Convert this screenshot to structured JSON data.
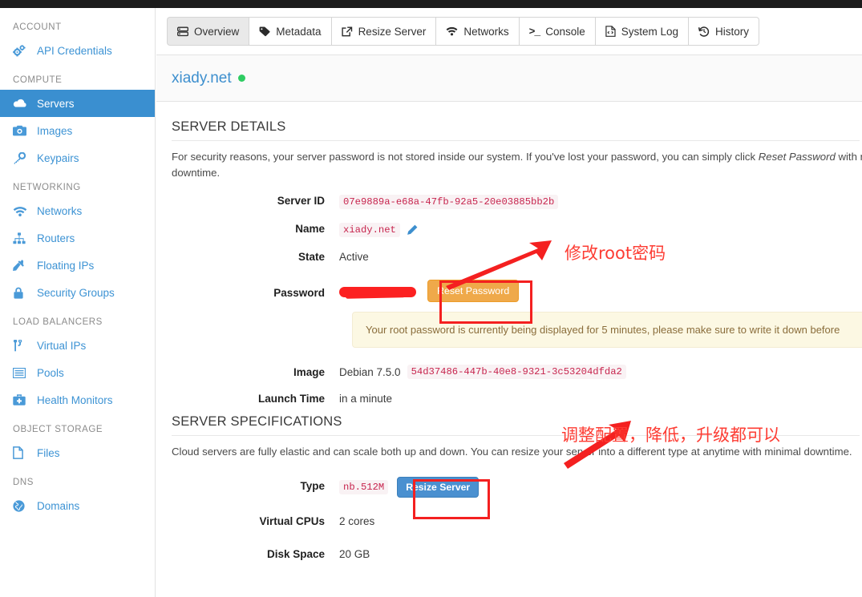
{
  "sidebar": {
    "sections": [
      {
        "label": "ACCOUNT",
        "items": [
          {
            "label": "API Credentials",
            "icon": "gears-icon",
            "active": false
          }
        ]
      },
      {
        "label": "COMPUTE",
        "items": [
          {
            "label": "Servers",
            "icon": "cloud-icon",
            "active": true
          },
          {
            "label": "Images",
            "icon": "camera-icon",
            "active": false
          },
          {
            "label": "Keypairs",
            "icon": "key-icon",
            "active": false
          }
        ]
      },
      {
        "label": "NETWORKING",
        "items": [
          {
            "label": "Networks",
            "icon": "wifi-icon",
            "active": false
          },
          {
            "label": "Routers",
            "icon": "sitemap-icon",
            "active": false
          },
          {
            "label": "Floating IPs",
            "icon": "plug-icon",
            "active": false
          },
          {
            "label": "Security Groups",
            "icon": "lock-icon",
            "active": false
          }
        ]
      },
      {
        "label": "LOAD BALANCERS",
        "items": [
          {
            "label": "Virtual IPs",
            "icon": "code-fork-icon",
            "active": false
          },
          {
            "label": "Pools",
            "icon": "list-icon",
            "active": false
          },
          {
            "label": "Health Monitors",
            "icon": "medkit-icon",
            "active": false
          }
        ]
      },
      {
        "label": "OBJECT STORAGE",
        "items": [
          {
            "label": "Files",
            "icon": "file-icon",
            "active": false
          }
        ]
      },
      {
        "label": "DNS",
        "items": [
          {
            "label": "Domains",
            "icon": "globe-icon",
            "active": false
          }
        ]
      }
    ]
  },
  "tabs": [
    {
      "label": "Overview",
      "icon": "server-icon",
      "active": true
    },
    {
      "label": "Metadata",
      "icon": "tag-icon",
      "active": false
    },
    {
      "label": "Resize Server",
      "icon": "external-link-icon",
      "active": false
    },
    {
      "label": "Networks",
      "icon": "wifi-icon",
      "active": false
    },
    {
      "label": "Console",
      "icon": "terminal-icon",
      "active": false
    },
    {
      "label": "System Log",
      "icon": "file-code-icon",
      "active": false
    },
    {
      "label": "History",
      "icon": "history-icon",
      "active": false
    }
  ],
  "header": {
    "server_name": "xiady.net",
    "status": "active",
    "status_color": "#2ecc62"
  },
  "server_details": {
    "title": "SERVER DETAILS",
    "description_before": "For security reasons, your server password is not stored inside our system. If you've lost your password, you can simply click ",
    "description_emphasis": "Reset Password",
    "description_after": " with no",
    "description_line2": "downtime.",
    "rows": {
      "server_id_label": "Server ID",
      "server_id_value": "07e9889a-e68a-47fb-92a5-20e03885bb2b",
      "name_label": "Name",
      "name_value": "xiady.net",
      "state_label": "State",
      "state_value": "Active",
      "password_label": "Password",
      "password_value_redacted": "",
      "reset_password_button": "Reset Password",
      "image_label": "Image",
      "image_value": "Debian 7.5.0",
      "image_id": "54d37486-447b-40e8-9321-3c53204dfda2",
      "launch_time_label": "Launch Time",
      "launch_time_value": "in a minute"
    },
    "alert": "Your root password is currently being displayed for 5 minutes, please make sure to write it down before"
  },
  "server_specifications": {
    "title": "SERVER SPECIFICATIONS",
    "description": "Cloud servers are fully elastic and can scale both up and down. You can resize your server into a different type at anytime with minimal downtime.",
    "rows": {
      "type_label": "Type",
      "type_value": "nb.512M",
      "resize_button": "Resize Server",
      "vcpu_label": "Virtual CPUs",
      "vcpu_value": "2 cores",
      "disk_label": "Disk Space",
      "disk_value": "20 GB"
    }
  },
  "annotations": {
    "color": "#fd3c33",
    "note_password": "修改root密码",
    "note_resize": "调整配置，降低，升级都可以"
  }
}
